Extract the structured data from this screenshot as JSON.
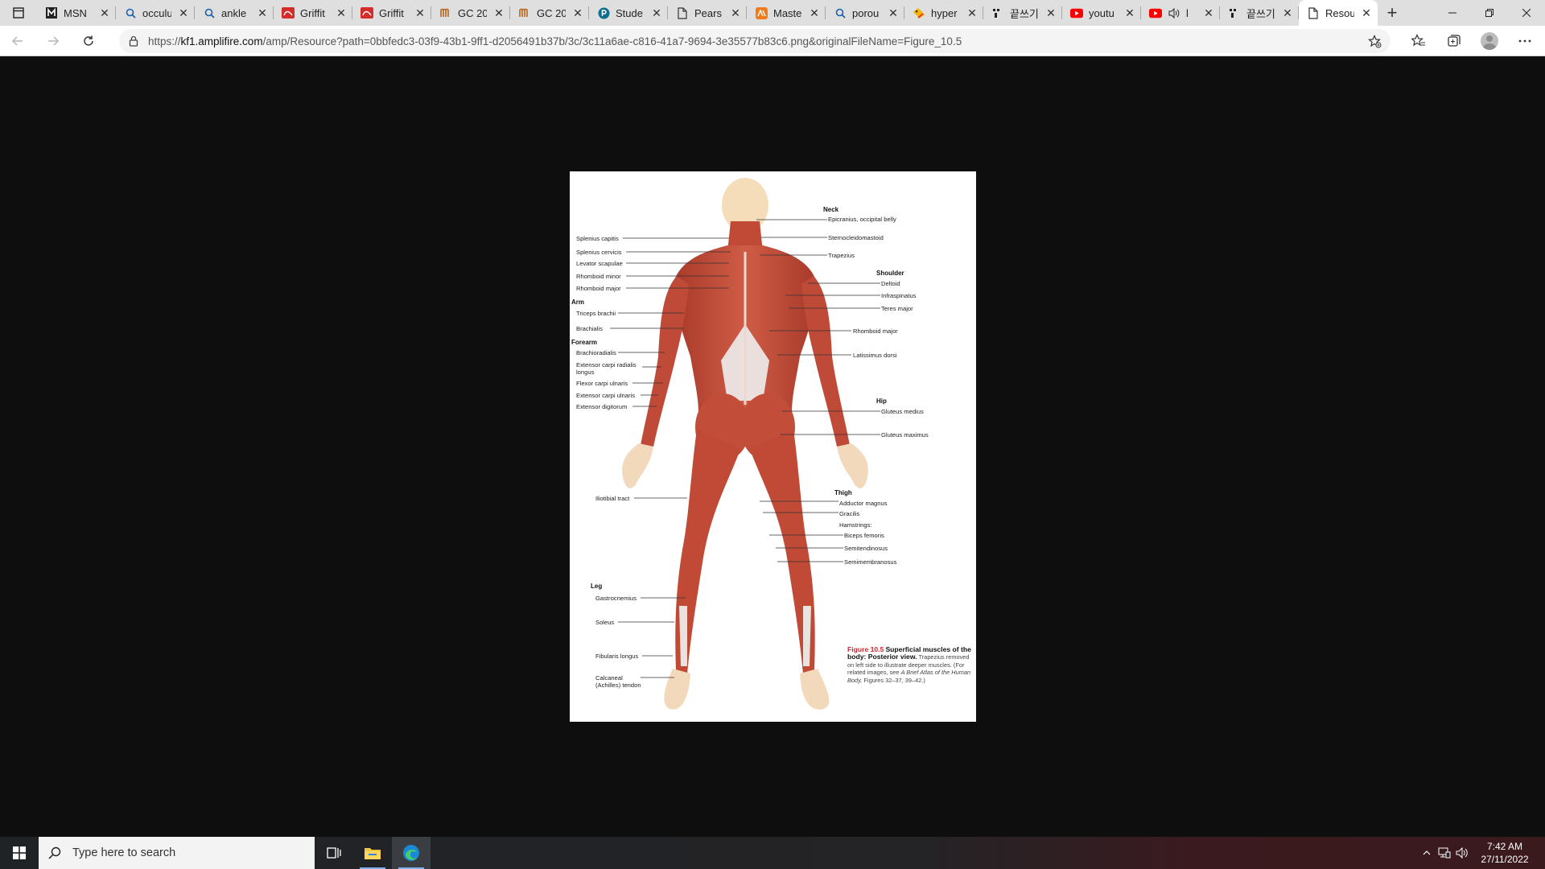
{
  "browser": {
    "tabs": [
      {
        "title": "MSN",
        "icon": "msn-icon"
      },
      {
        "title": "occulu",
        "icon": "search-icon"
      },
      {
        "title": "ankle",
        "icon": "search-icon"
      },
      {
        "title": "Griffit",
        "icon": "griffith-icon"
      },
      {
        "title": "Griffit",
        "icon": "griffith-icon"
      },
      {
        "title": "GC 20",
        "icon": "gc-icon"
      },
      {
        "title": "GC 20",
        "icon": "gc-icon"
      },
      {
        "title": "Stude",
        "icon": "pearson-p-icon"
      },
      {
        "title": "Pears",
        "icon": "document-icon"
      },
      {
        "title": "Maste",
        "icon": "mastering-icon"
      },
      {
        "title": "porou",
        "icon": "search-icon"
      },
      {
        "title": "hyper",
        "icon": "tag-icon"
      },
      {
        "title": "끝쓰기",
        "icon": "korean-app-icon"
      },
      {
        "title": "youtu",
        "icon": "youtube-icon"
      },
      {
        "title": "l",
        "icon": "youtube-icon"
      },
      {
        "title": "끝쓰기",
        "icon": "korean-app-icon"
      },
      {
        "title": "Resou",
        "icon": "document-icon",
        "active": true
      }
    ],
    "url_prefix": "https://",
    "url_host": "kf1.amplifire.com",
    "url_rest": "/amp/Resource?path=0bbfedc3-03f9-43b1-9ff1-d2056491b37b/3c/3c11a6ae-c816-41a7-9694-3e35577b83c6.png&originalFileName=Figure_10.5"
  },
  "figure": {
    "labels": {
      "neck": "Neck",
      "epicranius": "Epicranius, occipital belly",
      "sternocleidomastoid": "Sternocleidomastoid",
      "trapezius": "Trapezius",
      "shoulder": "Shoulder",
      "deltoid": "Deltoid",
      "infraspinatus": "Infraspinatus",
      "teres_major": "Teres major",
      "rhomboid_major_r": "Rhomboid major",
      "latissimus": "Latissimus dorsi",
      "hip": "Hip",
      "gluteus_medius": "Gluteus medius",
      "gluteus_maximus": "Gluteus maximus",
      "thigh": "Thigh",
      "adductor_magnus": "Adductor magnus",
      "gracilis": "Gracilis",
      "hamstrings": "Hamstrings:",
      "biceps_femoris": "Biceps femoris",
      "semitendinosus": "Semitendinosus",
      "semimembranosus": "Semimembranosus",
      "splenius_capitis": "Splenius capitis",
      "splenius_cervicis": "Splenius cervicis",
      "levator_scapulae": "Levator scapulae",
      "rhomboid_minor": "Rhomboid minor",
      "rhomboid_major_l": "Rhomboid major",
      "arm": "Arm",
      "triceps": "Triceps brachii",
      "brachialis": "Brachialis",
      "forearm": "Forearm",
      "brachioradialis": "Brachioradialis",
      "ecrl_1": "Extensor carpi radialis",
      "ecrl_2": "longus",
      "fcu": "Flexor carpi ulnaris",
      "ecu": "Extensor carpi ulnaris",
      "ext_digitorum": "Extensor digitorum",
      "iliotibial": "Iliotibial tract",
      "leg": "Leg",
      "gastrocnemius": "Gastrocnemius",
      "soleus": "Soleus",
      "fibularis": "Fibularis longus",
      "calcaneal_1": "Calcaneal",
      "calcaneal_2": "(Achilles) tendon"
    },
    "caption": {
      "number": "Figure 10.5",
      "title": "Superficial muscles of the body: Posterior view.",
      "body": "Trapezius removed on left side to illustrate deeper muscles. (For related images, see",
      "italic": "A Brief Atlas of the Human Body,",
      "end": "Figures 32–37, 39–42.)"
    }
  },
  "taskbar": {
    "search_placeholder": "Type here to search",
    "time": "7:42 AM",
    "date": "27/11/2022"
  }
}
